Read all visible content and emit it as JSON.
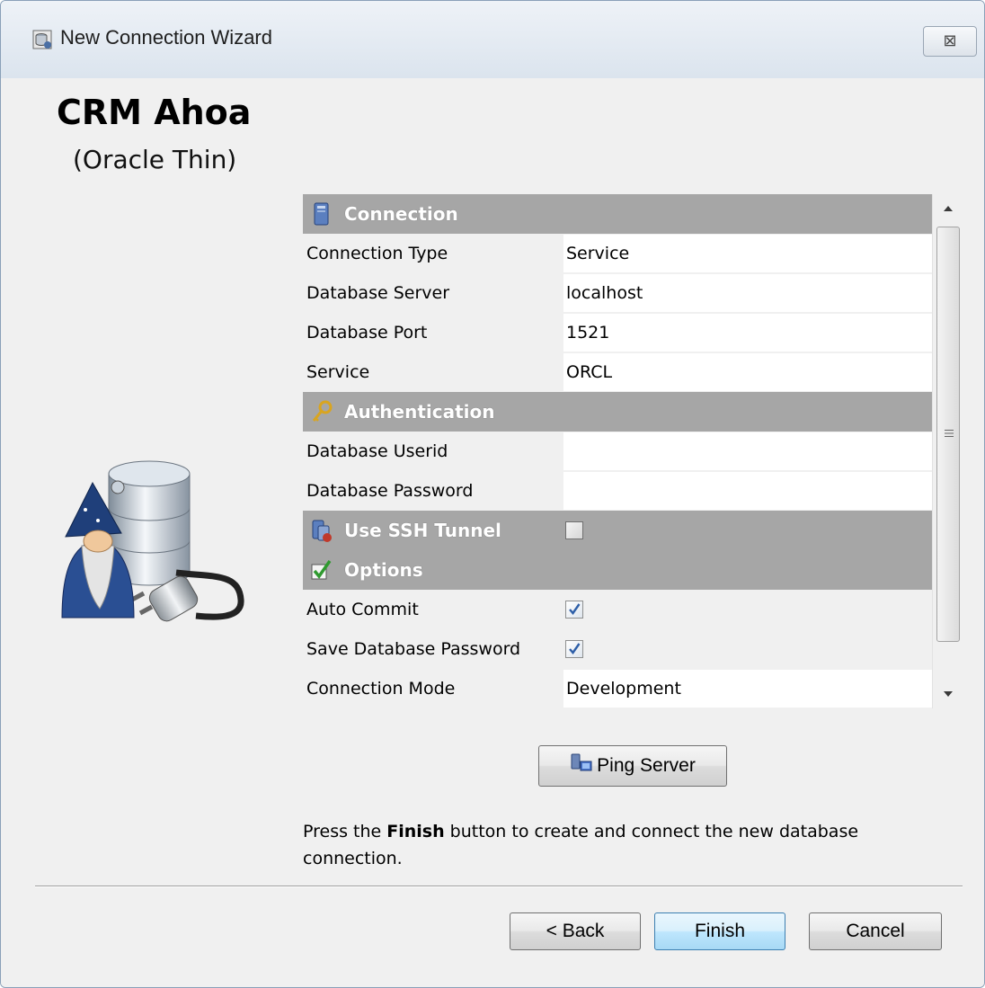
{
  "window": {
    "title": "New Connection Wizard",
    "close_symbol": "⊠",
    "title_icon": "database-wizard-icon"
  },
  "header": {
    "connection_name": "CRM Ahoa",
    "driver": "(Oracle Thin)"
  },
  "sections": {
    "connection": {
      "label": "Connection",
      "icon": "server-icon"
    },
    "authentication": {
      "label": "Authentication",
      "icon": "key-icon"
    },
    "ssh": {
      "label": "Use SSH Tunnel",
      "icon": "ssh-tunnel-icon",
      "checked": false
    },
    "options": {
      "label": "Options",
      "icon": "check-options-icon"
    }
  },
  "connection": {
    "type": {
      "label": "Connection Type",
      "value": "Service"
    },
    "server": {
      "label": "Database Server",
      "value": "localhost"
    },
    "port": {
      "label": "Database Port",
      "value": "1521"
    },
    "service": {
      "label": "Service",
      "value": "ORCL"
    }
  },
  "authentication": {
    "userid": {
      "label": "Database Userid",
      "value": ""
    },
    "password": {
      "label": "Database Password",
      "value": ""
    }
  },
  "options": {
    "auto_commit": {
      "label": "Auto Commit",
      "checked": true
    },
    "save_password": {
      "label": "Save Database Password",
      "checked": true
    },
    "mode": {
      "label": "Connection Mode",
      "value": "Development"
    }
  },
  "ping": {
    "label": "Ping Server",
    "icon": "ping-server-icon"
  },
  "hint": {
    "prefix": "Press the ",
    "bold": "Finish",
    "suffix": " button to create and connect the new database connection."
  },
  "buttons": {
    "back": "< Back",
    "finish": "Finish",
    "cancel": "Cancel"
  },
  "colors": {
    "section_header": "#a6a6a6",
    "default_button_border": "#3c7fb1",
    "checkmark": "#2e5fa8"
  }
}
